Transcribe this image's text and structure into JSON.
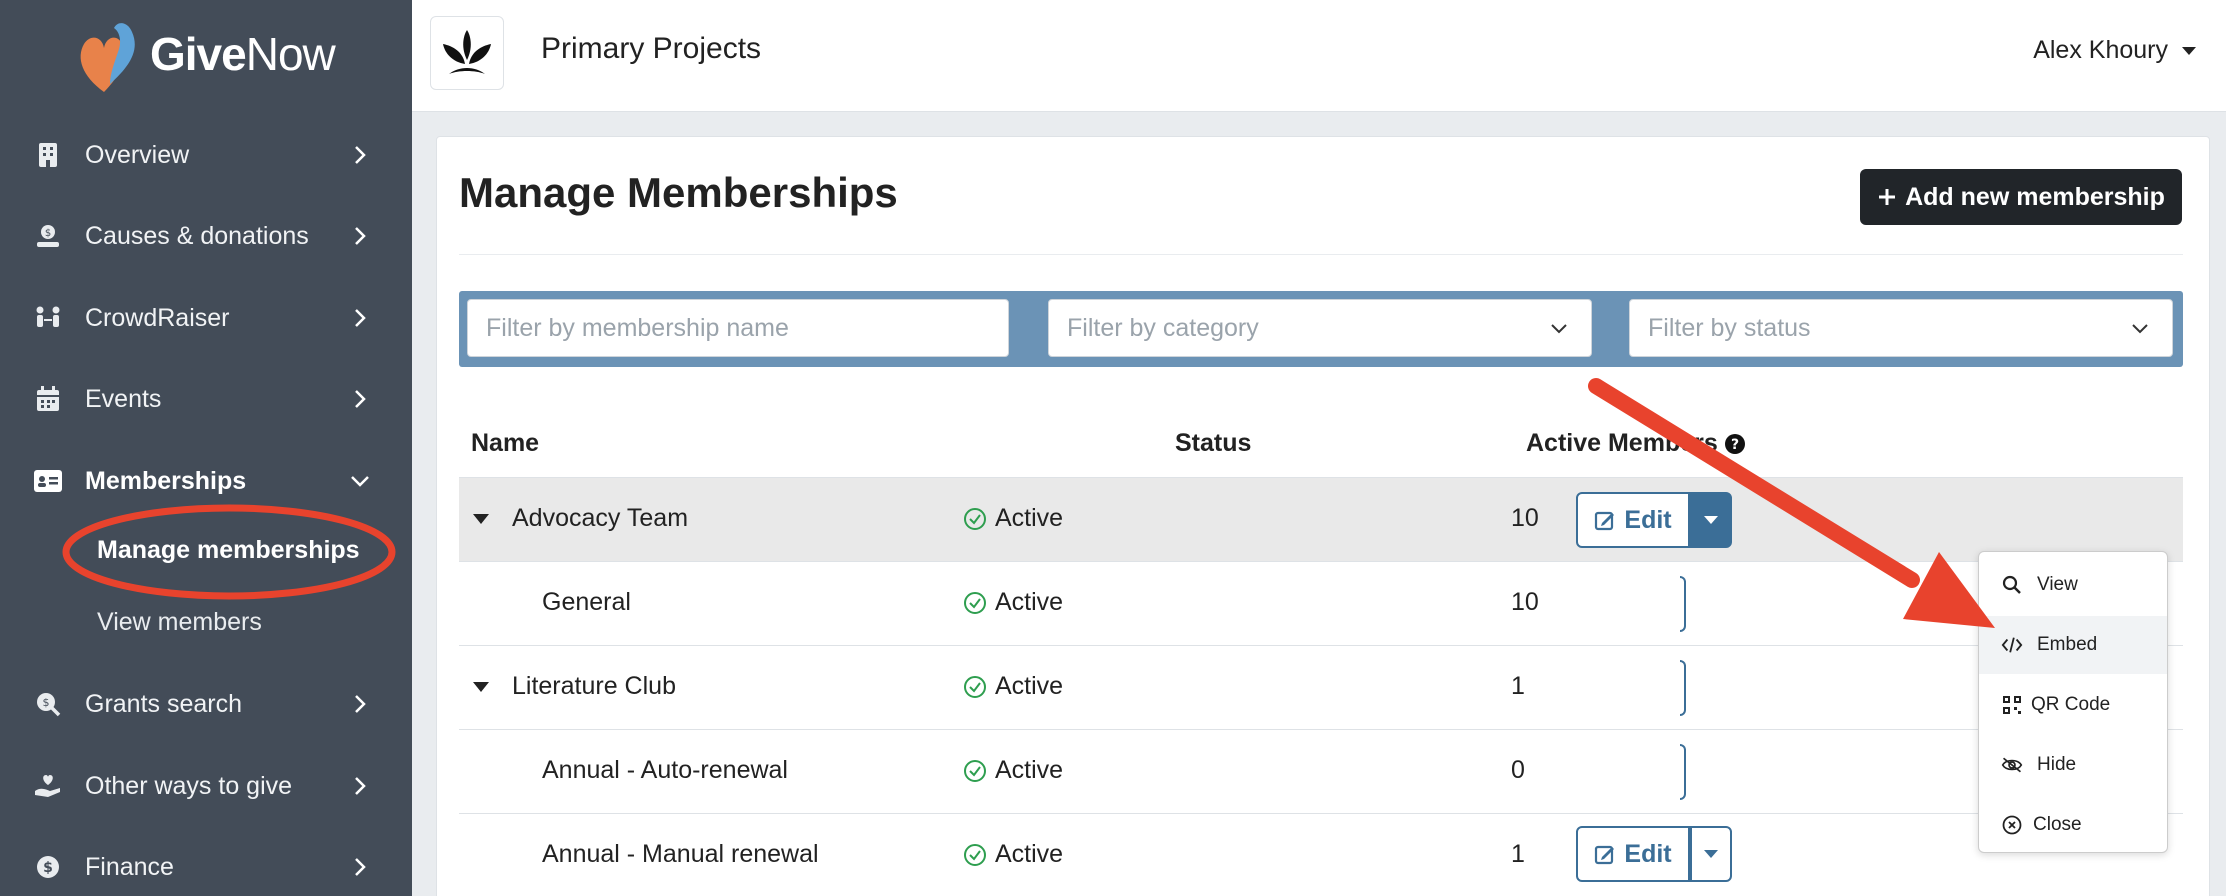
{
  "brand": {
    "name_bold": "Give",
    "name_regular": "Now"
  },
  "sidebar": {
    "items": [
      {
        "label": "Overview"
      },
      {
        "label": "Causes & donations"
      },
      {
        "label": "CrowdRaiser"
      },
      {
        "label": "Events"
      },
      {
        "label": "Memberships"
      },
      {
        "label": "Grants search"
      },
      {
        "label": "Other ways to give"
      },
      {
        "label": "Finance"
      }
    ],
    "sub_items": [
      {
        "label": "Manage memberships"
      },
      {
        "label": "View members"
      }
    ]
  },
  "header": {
    "title": "Primary Projects",
    "user": "Alex Khoury"
  },
  "main": {
    "title": "Manage Memberships",
    "add_button": "Add new membership",
    "filters": {
      "name_placeholder": "Filter by membership name",
      "category_placeholder": "Filter by category",
      "status_placeholder": "Filter by status"
    },
    "table": {
      "headers": [
        "Name",
        "Status",
        "Active Members"
      ],
      "rows": [
        {
          "name": "Advocacy Team",
          "status": "Active",
          "count": "10"
        },
        {
          "name": "General",
          "status": "Active",
          "count": "10"
        },
        {
          "name": "Literature Club",
          "status": "Active",
          "count": "1"
        },
        {
          "name": "Annual - Auto-renewal",
          "status": "Active",
          "count": "0"
        },
        {
          "name": "Annual - Manual renewal",
          "status": "Active",
          "count": "1"
        }
      ],
      "edit_label": "Edit"
    },
    "dropdown": {
      "items": [
        {
          "label": "View",
          "icon": "search-icon"
        },
        {
          "label": "Embed",
          "icon": "code-icon"
        },
        {
          "label": "QR Code",
          "icon": "qr-code-icon"
        },
        {
          "label": "Hide",
          "icon": "eye-slash-icon"
        },
        {
          "label": "Close",
          "icon": "close-circle-icon"
        }
      ]
    }
  },
  "colors": {
    "sidebar": "#434c58",
    "accent": "#3b6e97",
    "filter_bar": "#6b93b6",
    "annotation": "#e8432d",
    "active_green": "#2e9e4f"
  }
}
